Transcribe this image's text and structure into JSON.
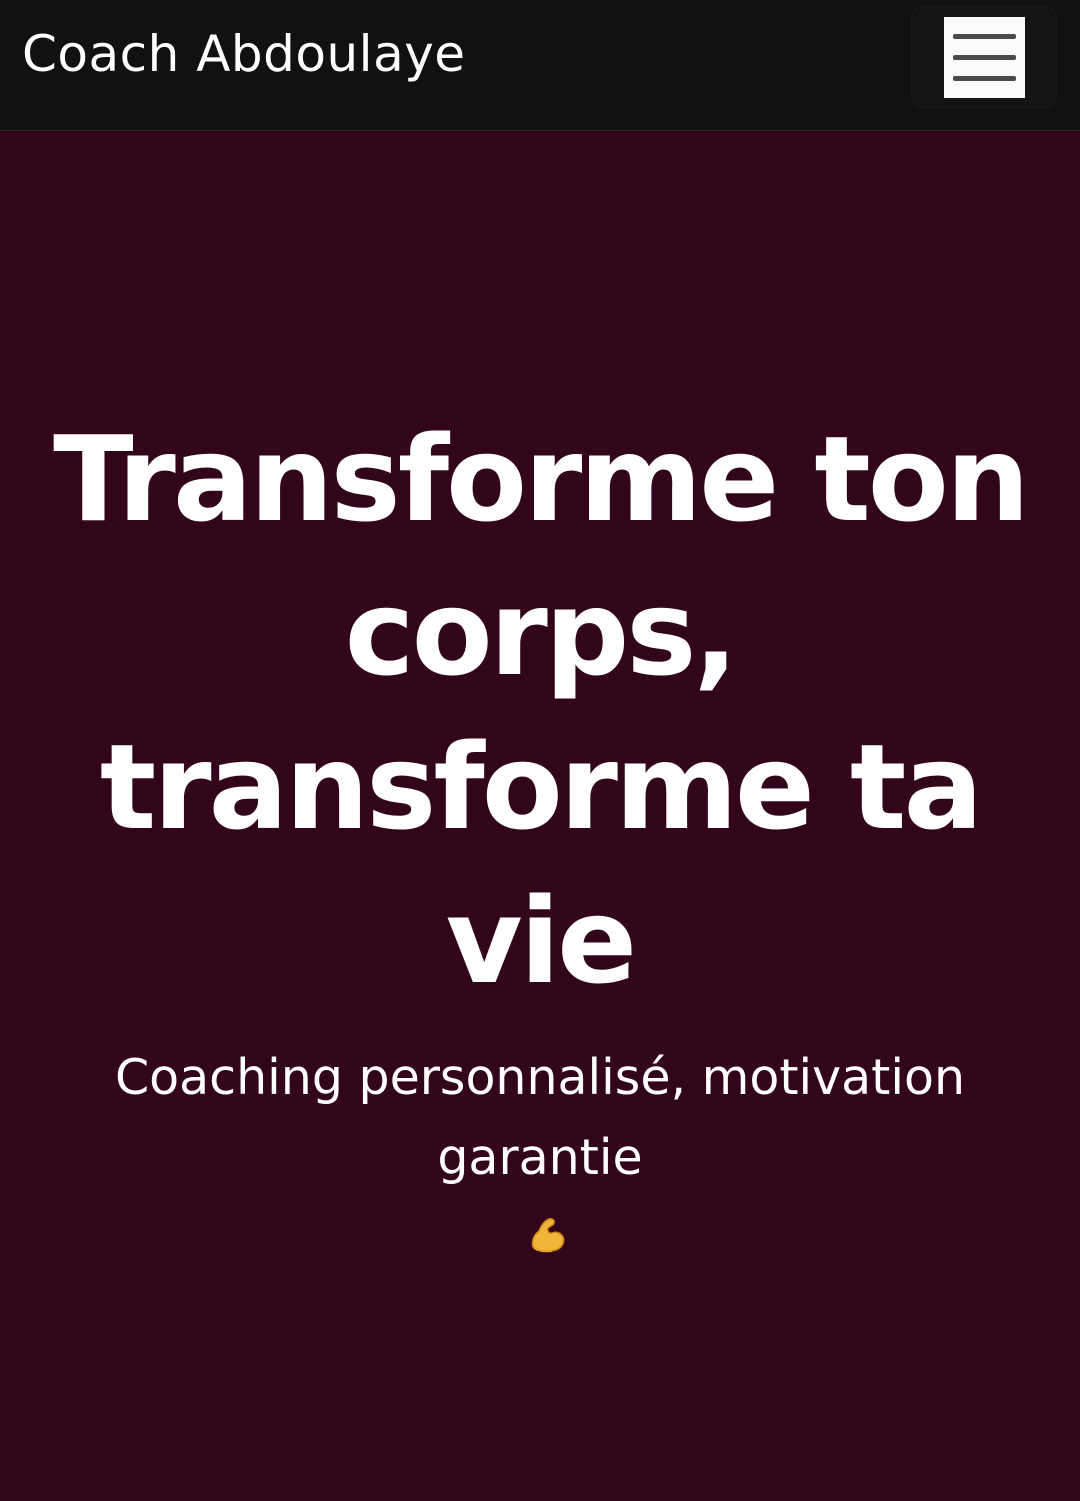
{
  "navbar": {
    "brand": "Coach Abdoulaye",
    "menu_icon": "hamburger-menu-icon"
  },
  "hero": {
    "title_lines": [
      "Transforme ton",
      "corps,",
      "transforme ta",
      "vie"
    ],
    "subtitle_line1": "Coaching personnalisé, motivation",
    "subtitle_line2": "garantie",
    "subtitle_icon": "flexed-biceps-icon"
  },
  "colors": {
    "navbar_bg": "#111111",
    "hero_bg": "#32051a",
    "text": "#ffffff"
  }
}
